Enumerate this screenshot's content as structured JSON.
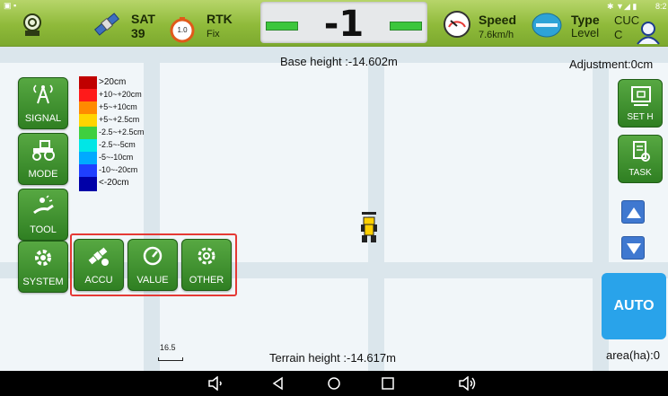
{
  "topbar": {
    "sat_label": "SAT",
    "sat_count": "39",
    "rtk_label": "RTK",
    "rtk_status": "Fix",
    "rtk_dial_value": "1.0",
    "deviation": "-1",
    "speed_label": "Speed",
    "speed_value": "7.6km/h",
    "type_label": "Type",
    "type_value": "Level",
    "extra_label": "CUC",
    "extra_value": "C",
    "clock": "8:2"
  },
  "map": {
    "base_height": "Base height :-14.602m",
    "terrain_height": "Terrain height :-14.617m",
    "adjustment": "Adjustment:0cm",
    "area": "area(ha):0",
    "scale_value": "16.5"
  },
  "legend": [
    {
      "label": ">20cm",
      "color": "#c00000"
    },
    {
      "label": "+10~+20cm",
      "color": "#ff1a1a"
    },
    {
      "label": "+5~+10cm",
      "color": "#ff8a00"
    },
    {
      "label": "+5~+2.5cm",
      "color": "#ffd400"
    },
    {
      "label": "-2.5~+2.5cm",
      "color": "#3fcf3f"
    },
    {
      "label": "-2.5~-5cm",
      "color": "#00e6e6"
    },
    {
      "label": "-5~-10cm",
      "color": "#00aaff"
    },
    {
      "label": "-10~-20cm",
      "color": "#1f3fff"
    },
    {
      "label": "<-20cm",
      "color": "#0000a8"
    }
  ],
  "left_menu": {
    "signal": "SIGNAL",
    "mode": "MODE",
    "tool": "TOOL",
    "system": "SYSTEM",
    "accu": "ACCU",
    "value": "VALUE",
    "other": "OTHER"
  },
  "right_menu": {
    "set_h": "SET H",
    "task": "TASK",
    "auto": "AUTO"
  },
  "colors": {
    "green_button": "#3e8f2c",
    "auto_button": "#29a3ea",
    "highlight": "#e53935"
  }
}
